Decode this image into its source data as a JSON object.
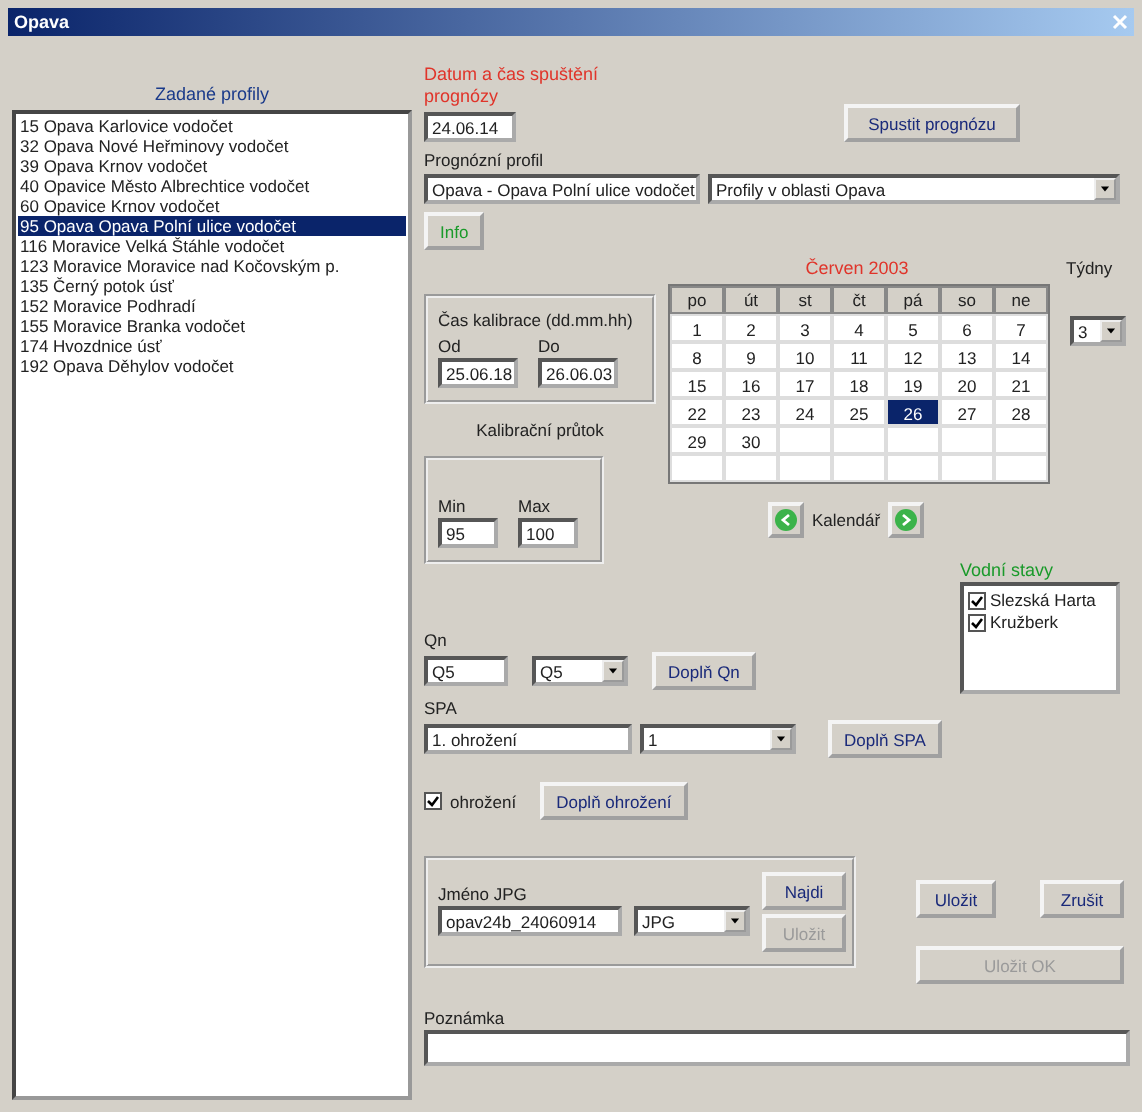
{
  "window": {
    "title": "Opava"
  },
  "profiles": {
    "heading": "Zadané profily",
    "items": [
      {
        "text": "15  Opava  Karlovice vodočet",
        "selected": false
      },
      {
        "text": "32  Opava  Nové Heřminovy vodočet",
        "selected": false
      },
      {
        "text": "39  Opava  Krnov vodočet",
        "selected": false
      },
      {
        "text": "40  Opavice  Město Albrechtice vodočet",
        "selected": false
      },
      {
        "text": "60  Opavice  Krnov vodočet",
        "selected": false
      },
      {
        "text": "95  Opava  Opava Polní ulice vodočet",
        "selected": true
      },
      {
        "text": "116  Moravice  Velká Štáhle vodočet",
        "selected": false
      },
      {
        "text": "123  Moravice  Moravice nad Kočovským p.",
        "selected": false
      },
      {
        "text": "135  Černý potok  úsť",
        "selected": false
      },
      {
        "text": "152  Moravice  Podhradí",
        "selected": false
      },
      {
        "text": "155  Moravice  Branka vodočet",
        "selected": false
      },
      {
        "text": "174  Hvozdnice  úsť",
        "selected": false
      },
      {
        "text": "192  Opava  Děhylov vodočet",
        "selected": false
      }
    ]
  },
  "start": {
    "label": "Datum a čas spuštění prognózy",
    "value": "24.06.14",
    "button": "Spustit prognózu"
  },
  "profile": {
    "label": "Prognózní profil",
    "value": "Opava - Opava Polní ulice vodočet",
    "area": "Profily v oblasti Opava",
    "info": "Info"
  },
  "calibration": {
    "title": "Čas kalibrace (dd.mm.hh)",
    "from_label": "Od",
    "from": "25.06.18",
    "to_label": "Do",
    "to": "26.06.03"
  },
  "flow": {
    "label": "Kalibrační průtok",
    "min_label": "Min",
    "min": "95",
    "max_label": "Max",
    "max": "100"
  },
  "calendar": {
    "title": "Červen 2003",
    "days": [
      "po",
      "út",
      "st",
      "čt",
      "pá",
      "so",
      "ne"
    ],
    "dates": [
      {
        "day": "1",
        "selected": false
      },
      {
        "day": "2",
        "selected": false
      },
      {
        "day": "3",
        "selected": false
      },
      {
        "day": "4",
        "selected": false
      },
      {
        "day": "5",
        "selected": false
      },
      {
        "day": "6",
        "selected": false
      },
      {
        "day": "7",
        "selected": false
      },
      {
        "day": "8",
        "selected": false
      },
      {
        "day": "9",
        "selected": false
      },
      {
        "day": "10",
        "selected": false
      },
      {
        "day": "11",
        "selected": false
      },
      {
        "day": "12",
        "selected": false
      },
      {
        "day": "13",
        "selected": false
      },
      {
        "day": "14",
        "selected": false
      },
      {
        "day": "15",
        "selected": false
      },
      {
        "day": "16",
        "selected": false
      },
      {
        "day": "17",
        "selected": false
      },
      {
        "day": "18",
        "selected": false
      },
      {
        "day": "19",
        "selected": false
      },
      {
        "day": "20",
        "selected": false
      },
      {
        "day": "21",
        "selected": false
      },
      {
        "day": "22",
        "selected": false
      },
      {
        "day": "23",
        "selected": false
      },
      {
        "day": "24",
        "selected": false
      },
      {
        "day": "25",
        "selected": false
      },
      {
        "day": "26",
        "selected": true
      },
      {
        "day": "27",
        "selected": false
      },
      {
        "day": "28",
        "selected": false
      },
      {
        "day": "29",
        "selected": false
      },
      {
        "day": "30",
        "selected": false
      }
    ],
    "nav_label": "Kalendář"
  },
  "weeks_select": {
    "label": "Týdny",
    "value": "3"
  },
  "water_levels": {
    "label": "Vodní stavy",
    "items": [
      {
        "text": "Slezská Harta",
        "checked": true
      },
      {
        "text": "Kružberk",
        "checked": true
      }
    ]
  },
  "qn": {
    "label": "Qn",
    "value": "Q5",
    "select": "Q5",
    "button": "Doplň Qn"
  },
  "spa": {
    "label": "SPA",
    "value": "1. ohrožení",
    "select": "1",
    "button": "Doplň SPA"
  },
  "threat": {
    "label": "ohrožení",
    "checked": true,
    "button": "Doplň ohrožení"
  },
  "jpg": {
    "label": "Jméno JPG",
    "value": "opav24b_24060914",
    "format": "JPG",
    "find": "Najdi",
    "save": "Uložit",
    "save_disabled": true
  },
  "actions": {
    "save": "Uložit",
    "cancel": "Zrušit",
    "ok": "Uložit OK",
    "ok_disabled": true
  },
  "note": {
    "label": "Poznámka"
  }
}
